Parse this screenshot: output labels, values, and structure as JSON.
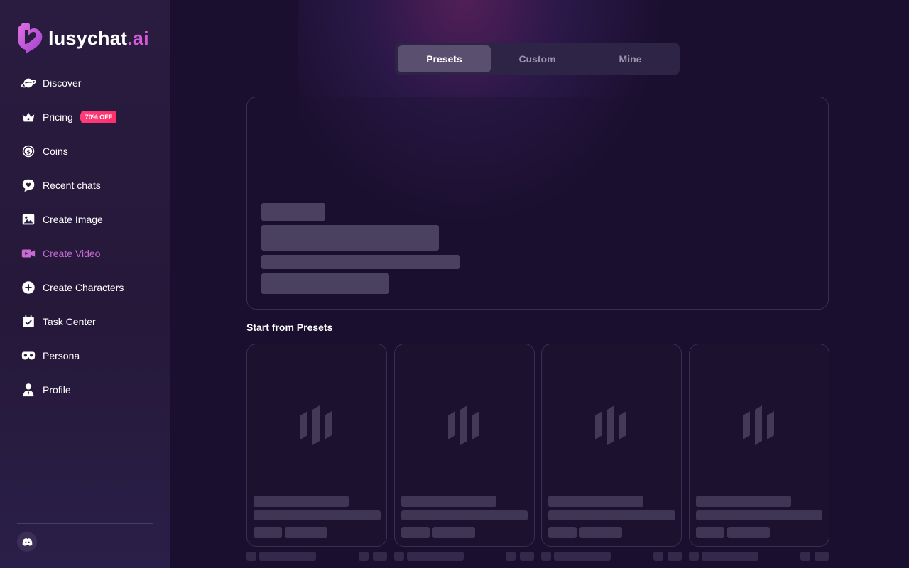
{
  "app": {
    "logo_text": "lusychat",
    "logo_suffix": ".ai"
  },
  "sidebar": {
    "items": [
      {
        "label": "Discover",
        "icon": "planet-icon"
      },
      {
        "label": "Pricing",
        "icon": "crown-icon",
        "badge": "70% OFF"
      },
      {
        "label": "Coins",
        "icon": "coin-icon"
      },
      {
        "label": "Recent chats",
        "icon": "chat-heart-icon"
      },
      {
        "label": "Create Image",
        "icon": "image-icon"
      },
      {
        "label": "Create Video",
        "icon": "video-icon",
        "active": true
      },
      {
        "label": "Create Characters",
        "icon": "plus-circle-icon"
      },
      {
        "label": "Task Center",
        "icon": "calendar-check-icon"
      },
      {
        "label": "Persona",
        "icon": "mask-icon"
      },
      {
        "label": "Profile",
        "icon": "user-icon"
      }
    ],
    "footer_icon": "discord-icon"
  },
  "tabs": [
    {
      "label": "Presets",
      "active": true
    },
    {
      "label": "Custom"
    },
    {
      "label": "Mine"
    }
  ],
  "section": {
    "title": "Start from Presets"
  },
  "colors": {
    "accent": "#c86ad4",
    "badge": "#ff3d7a",
    "background": "#1a0f2e",
    "sidebar": "#2a1c40"
  }
}
